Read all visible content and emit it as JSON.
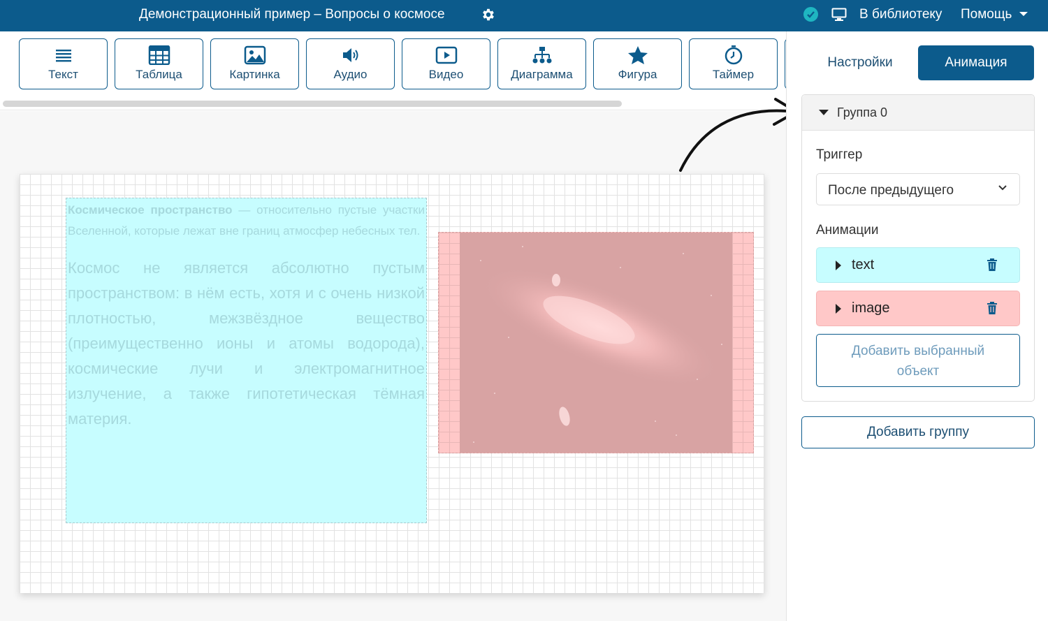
{
  "topbar": {
    "title": "Демонстрационный пример – Вопросы о космосе",
    "library_link": "В библиотеку",
    "help_menu": "Помощь",
    "settings_icon": "gear-icon",
    "status_icon": "check-circle-icon",
    "preview_icon": "monitor-icon"
  },
  "toolbar": {
    "tools": [
      {
        "label": "Текст",
        "icon": "text-lines-icon"
      },
      {
        "label": "Таблица",
        "icon": "table-icon"
      },
      {
        "label": "Картинка",
        "icon": "image-icon"
      },
      {
        "label": "Аудио",
        "icon": "speaker-icon"
      },
      {
        "label": "Видео",
        "icon": "video-play-icon"
      },
      {
        "label": "Диаграмма",
        "icon": "hierarchy-icon"
      },
      {
        "label": "Фигура",
        "icon": "star-icon"
      },
      {
        "label": "Таймер",
        "icon": "stopwatch-icon"
      }
    ]
  },
  "slide": {
    "text_bold": "Космическое пространство",
    "text_p1_rest": " — относительно пустые участки Вселенной, которые лежат вне границ атмосфер небесных тел.",
    "text_p2": "Космос не является абсолютно пустым пространством: в нём есть, хотя и с очень низкой плотностью, межзвёздное вещество (преимущественно ионы и атомы водорода), космические лучи и электромагнитное излучение, а также гипотетическая тёмная материя."
  },
  "panel": {
    "tab_settings": "Настройки",
    "tab_animation": "Анимация",
    "group_title": "Группа 0",
    "trigger_label": "Триггер",
    "trigger_value": "После предыдущего",
    "animations_label": "Анимации",
    "animations": [
      {
        "name": "text",
        "color": "#c7fdff"
      },
      {
        "name": "image",
        "color": "#ffc8c8"
      }
    ],
    "add_selected_line1": "Добавить выбранный",
    "add_selected_line2": "объект",
    "add_group": "Добавить группу"
  },
  "colors": {
    "brand": "#0c5b8c",
    "text_highlight": "#c7fdff",
    "image_highlight": "#ffc8c8"
  }
}
